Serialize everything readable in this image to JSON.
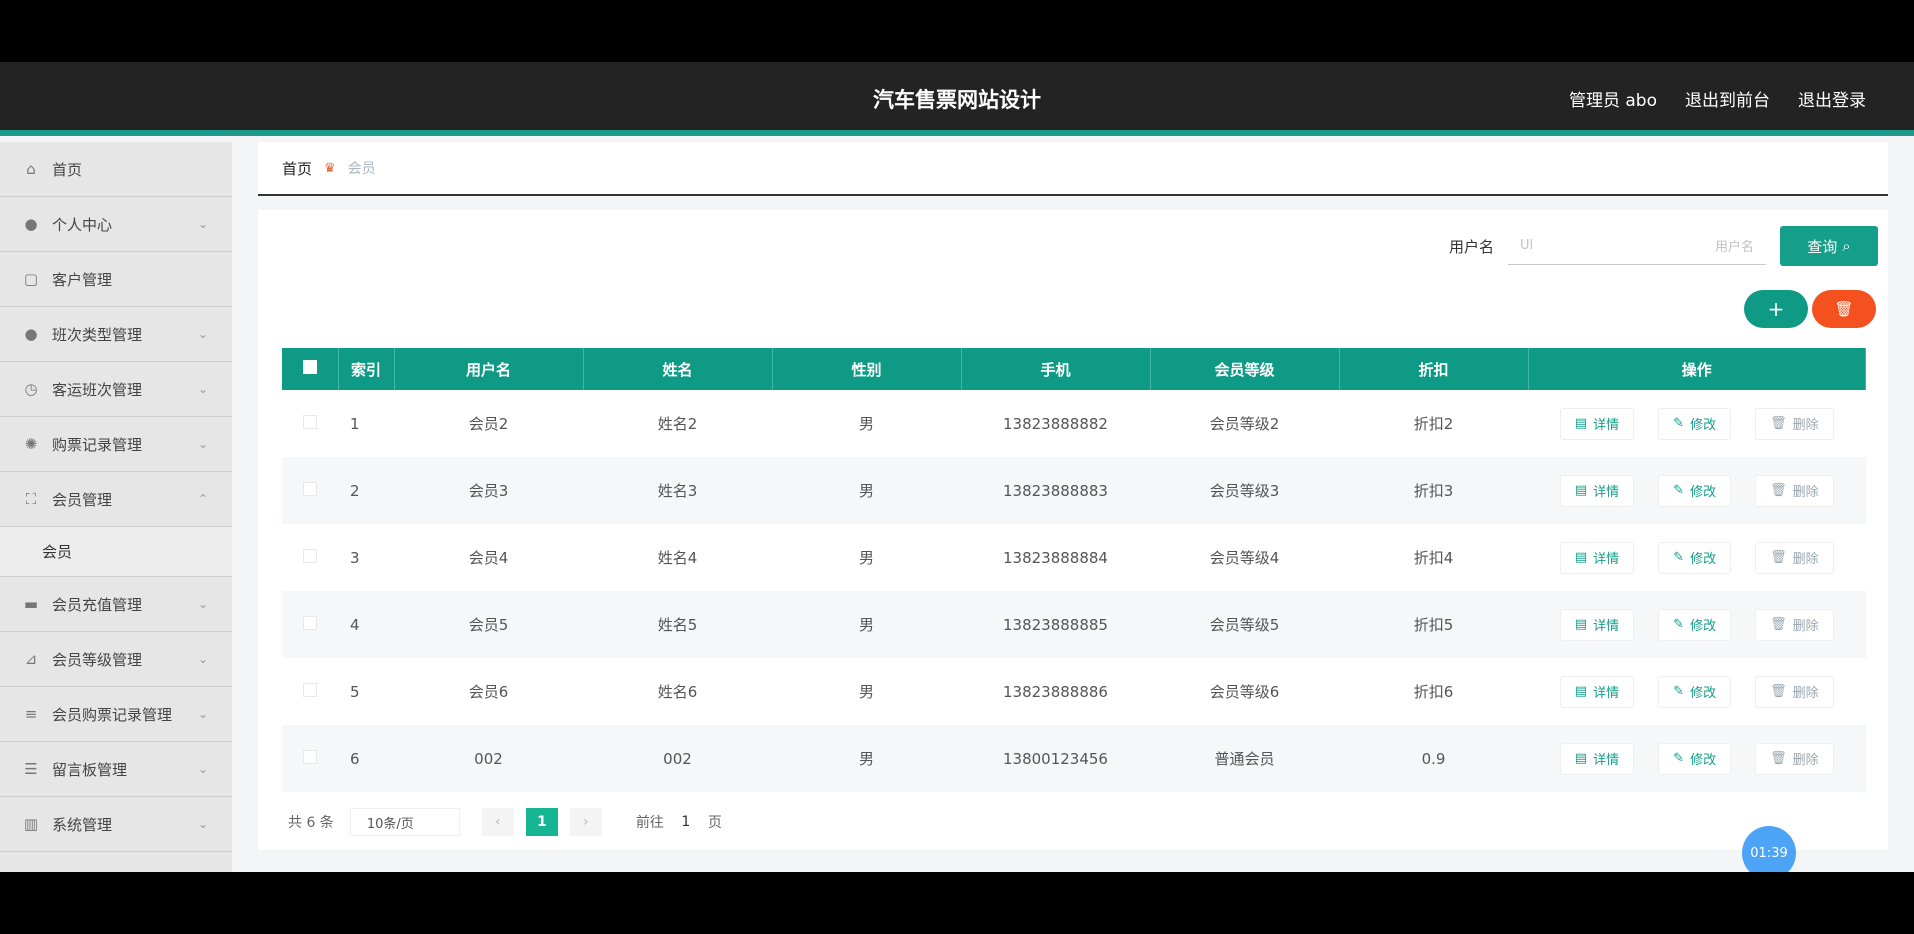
{
  "header": {
    "title": "汽车售票网站设计",
    "admin": "管理员 abo",
    "front": "退出到前台",
    "logout": "退出登录"
  },
  "sidebar": {
    "items": [
      {
        "label": "首页",
        "icon": "home-icon"
      },
      {
        "label": "个人中心",
        "icon": "user-icon"
      },
      {
        "label": "客户管理",
        "icon": "frame-icon"
      },
      {
        "label": "班次类型管理",
        "icon": "user-group-icon"
      },
      {
        "label": "客运班次管理",
        "icon": "clock-icon"
      },
      {
        "label": "购票记录管理",
        "icon": "gear-icon"
      },
      {
        "label": "会员管理",
        "icon": "expand-icon"
      },
      {
        "label": "会员充值管理",
        "icon": "card-icon"
      },
      {
        "label": "会员等级管理",
        "icon": "chart-icon"
      },
      {
        "label": "会员购票记录管理",
        "icon": "list-icon"
      },
      {
        "label": "留言板管理",
        "icon": "sliders-icon"
      },
      {
        "label": "系统管理",
        "icon": "bars-icon"
      }
    ],
    "sub_item": "会员"
  },
  "breadcrumb": {
    "home": "首页",
    "current": "会员"
  },
  "search": {
    "label": "用户名",
    "value": "Ul",
    "placeholder": "用户名",
    "button": "查询"
  },
  "actions": {
    "add": "+",
    "delete": "🗑"
  },
  "table": {
    "headers": [
      "索引",
      "用户名",
      "姓名",
      "性别",
      "手机",
      "会员等级",
      "折扣",
      "操作"
    ],
    "rows": [
      {
        "idx": "1",
        "username": "会员2",
        "name": "姓名2",
        "gender": "男",
        "phone": "13823888882",
        "level": "会员等级2",
        "discount": "折扣2"
      },
      {
        "idx": "2",
        "username": "会员3",
        "name": "姓名3",
        "gender": "男",
        "phone": "13823888883",
        "level": "会员等级3",
        "discount": "折扣3"
      },
      {
        "idx": "3",
        "username": "会员4",
        "name": "姓名4",
        "gender": "男",
        "phone": "13823888884",
        "level": "会员等级4",
        "discount": "折扣4"
      },
      {
        "idx": "4",
        "username": "会员5",
        "name": "姓名5",
        "gender": "男",
        "phone": "13823888885",
        "level": "会员等级5",
        "discount": "折扣5"
      },
      {
        "idx": "5",
        "username": "会员6",
        "name": "姓名6",
        "gender": "男",
        "phone": "13823888886",
        "level": "会员等级6",
        "discount": "折扣6"
      },
      {
        "idx": "6",
        "username": "002",
        "name": "002",
        "gender": "男",
        "phone": "13800123456",
        "level": "普通会员",
        "discount": "0.9"
      }
    ],
    "op_detail": "详情",
    "op_edit": "修改",
    "op_delete": "删除"
  },
  "pager": {
    "total": "共 6 条",
    "page_size": "10条/页",
    "prev": "‹",
    "current": "1",
    "next": "›",
    "goto": "前往",
    "page": "1",
    "page_unit": "页"
  },
  "clock": "01:39",
  "colors": {
    "accent": "#0f9a86",
    "danger": "#f4511e",
    "topbar": "#232323"
  }
}
